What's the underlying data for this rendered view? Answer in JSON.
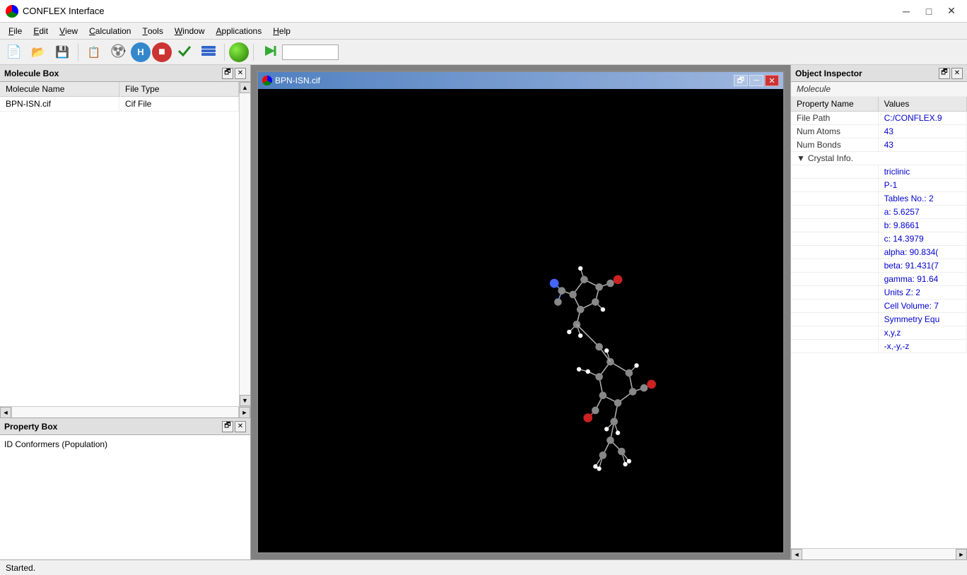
{
  "titleBar": {
    "title": "CONFLEX Interface",
    "minimize": "─",
    "maximize": "□",
    "close": "✕"
  },
  "menuBar": {
    "items": [
      "File",
      "Edit",
      "View",
      "Calculation",
      "Tools",
      "Window",
      "Applications",
      "Help"
    ]
  },
  "toolbar": {
    "inputPlaceholder": ""
  },
  "moleculeBox": {
    "title": "Molecule Box",
    "columns": [
      "Molecule Name",
      "File Type"
    ],
    "rows": [
      {
        "name": "BPN-ISN.cif",
        "type": "Cif File"
      }
    ]
  },
  "propertyBox": {
    "title": "Property Box",
    "content": "ID Conformers (Population)"
  },
  "moleculeWindow": {
    "title": "BPN-ISN.cif",
    "btnRestore": "🗗",
    "btnMinimize": "─",
    "btnClose": "✕"
  },
  "objectInspector": {
    "title": "Object Inspector",
    "section": "Molecule",
    "columns": [
      "Property Name",
      "Values"
    ],
    "properties": [
      {
        "name": "File Path",
        "value": "C:/CONFLEX.9",
        "indent": false
      },
      {
        "name": "Num Atoms",
        "value": "43",
        "indent": false
      },
      {
        "name": "Num Bonds",
        "value": "43",
        "indent": false
      },
      {
        "name": "Crystal Info.",
        "value": "",
        "isGroup": true,
        "expanded": true
      },
      {
        "name": "",
        "value": "triclinic",
        "indent": true
      },
      {
        "name": "",
        "value": "P-1",
        "indent": true
      },
      {
        "name": "",
        "value": "Tables No.: 2",
        "indent": true
      },
      {
        "name": "",
        "value": "a: 5.6257",
        "indent": true
      },
      {
        "name": "",
        "value": "b: 9.8661",
        "indent": true
      },
      {
        "name": "",
        "value": "c: 14.3979",
        "indent": true
      },
      {
        "name": "",
        "value": "alpha: 90.834(",
        "indent": true
      },
      {
        "name": "",
        "value": "beta: 91.431(7",
        "indent": true
      },
      {
        "name": "",
        "value": "gamma: 91.64",
        "indent": true
      },
      {
        "name": "",
        "value": "Units Z: 2",
        "indent": true
      },
      {
        "name": "",
        "value": "Cell Volume: 7",
        "indent": true
      },
      {
        "name": "",
        "value": "Symmetry Equ",
        "indent": true
      },
      {
        "name": "",
        "value": "x,y,z",
        "indent": true
      },
      {
        "name": "",
        "value": "-x,-y,-z",
        "indent": true
      }
    ]
  },
  "statusBar": {
    "text": "Started."
  }
}
